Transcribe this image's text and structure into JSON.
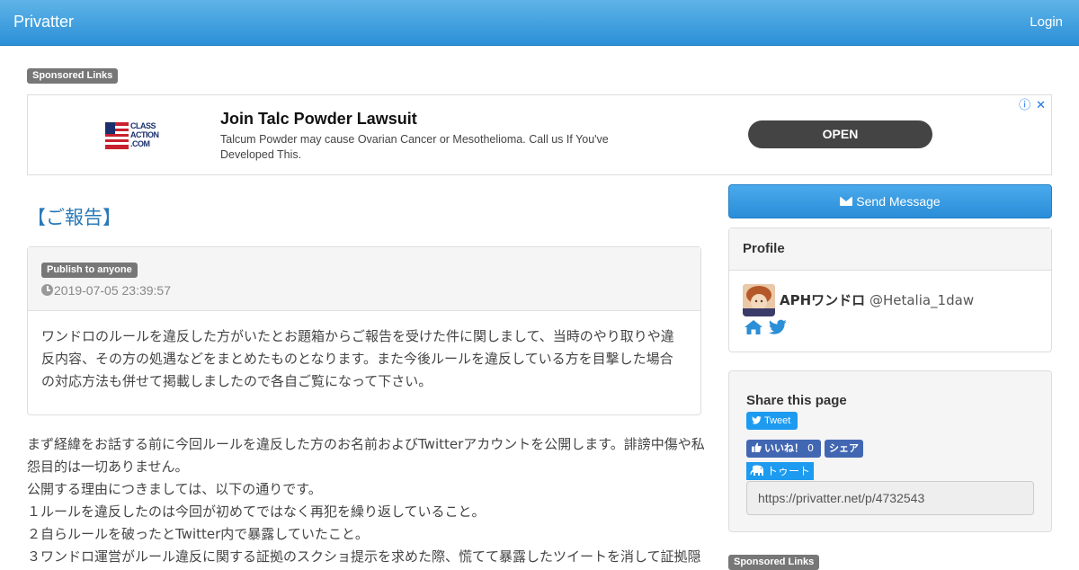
{
  "navbar": {
    "brand": "Privatter",
    "login": "Login"
  },
  "sponsored_label": "Sponsored Links",
  "ad": {
    "logo_text": [
      "CLASS",
      "ACTION",
      ".COM"
    ],
    "title": "Join Talc Powder Lawsuit",
    "description": "Talcum Powder may cause Ovarian Cancer or Mesothelioma. Call us If You've Developed This.",
    "button": "OPEN",
    "info_icon": "ⓘ",
    "close_icon": "✕"
  },
  "post": {
    "title": "【ご報告】",
    "visibility": "Publish to anyone",
    "date": "2019-07-05 23:39:57",
    "summary": "ワンドロのルールを違反した方がいたとお題箱からご報告を受けた件に関しまして、当時のやり取りや違反内容、その方の処遇などをまとめたものとなります。また今後ルールを違反している方を目撃した場合の対応方法も併せて掲載しましたので各自ご覧になって下さい。",
    "paragraphs": [
      "まず経緯をお話する前に今回ルールを違反した方のお名前およびTwitterアカウントを公開します。誹謗中傷や私怨目的は一切ありません。",
      "公開する理由につきましては、以下の通りです。",
      "１ルールを違反したのは今回が初めてではなく再犯を繰り返していること。",
      "２自らルールを破ったとTwitter内で暴露していたこと。",
      "３ワンドロ運営がルール違反に関する証拠のスクショ提示を求めた際、慌てて暴露したツイートを消して証拠隠"
    ]
  },
  "sidebar": {
    "send_message": "Send Message",
    "profile_heading": "Profile",
    "profile_name": "APHワンドロ",
    "profile_handle": "@Hetalia_1daw",
    "share_heading": "Share this page",
    "tweet_label": "Tweet",
    "fb_like": "いいね！",
    "fb_count": "0",
    "fb_share": "シェア",
    "toot_label": "トゥート",
    "share_url": "https://privatter.net/p/4732543"
  },
  "colors": {
    "navbar": "#2b8fd6",
    "title_link": "#2a7ab8",
    "twitter": "#1d9bf0",
    "facebook": "#4267b2"
  }
}
